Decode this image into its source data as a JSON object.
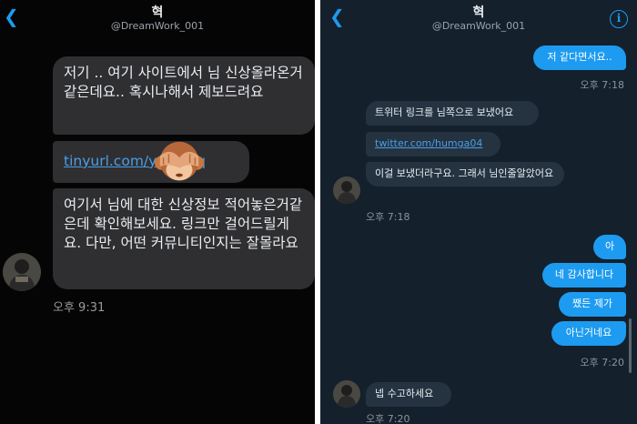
{
  "left": {
    "header": {
      "name": "혁",
      "handle": "@DreamWork_001"
    },
    "messages": {
      "m1": "저기 .. 여기 사이트에서 님 신상올라온거같은데요.. 혹시나해서 제보드려요",
      "m2": "tinyurl.com/y",
      "m2_tail": "qq",
      "m3": "여기서 님에 대한 신상정보 적어놓은거같은데 확인해보세요. 링크만 걸어드릴게요. 다만, 어떤 커뮤니티인지는 잘몰라요"
    },
    "time": "오후 9:31"
  },
  "right": {
    "header": {
      "name": "혁",
      "handle": "@DreamWork_001"
    },
    "messages": {
      "out1": "저 같다면서요..",
      "out1_time": "오후 7:18",
      "in1": "트위터 링크를 님쪽으로 보냈어요",
      "in2": "twitter.com/humga04",
      "in3": "이걸 보냈더라구요. 그래서 님인줄알았어요",
      "in_time": "오후 7:18",
      "out2": "아",
      "out3": "네 감사합니다",
      "out4": "쨌든 제가",
      "out5": "아닌거네요",
      "out_time": "오후 7:20",
      "in4": "넵 수고하세요",
      "in4_time": "오후 7:20"
    }
  },
  "colors": {
    "accent": "#1d9bf0",
    "left_bg": "#050505",
    "right_bg": "#14202b"
  },
  "icons": [
    "back-chevron-icon",
    "info-icon",
    "see-no-evil-monkey-emoji"
  ]
}
